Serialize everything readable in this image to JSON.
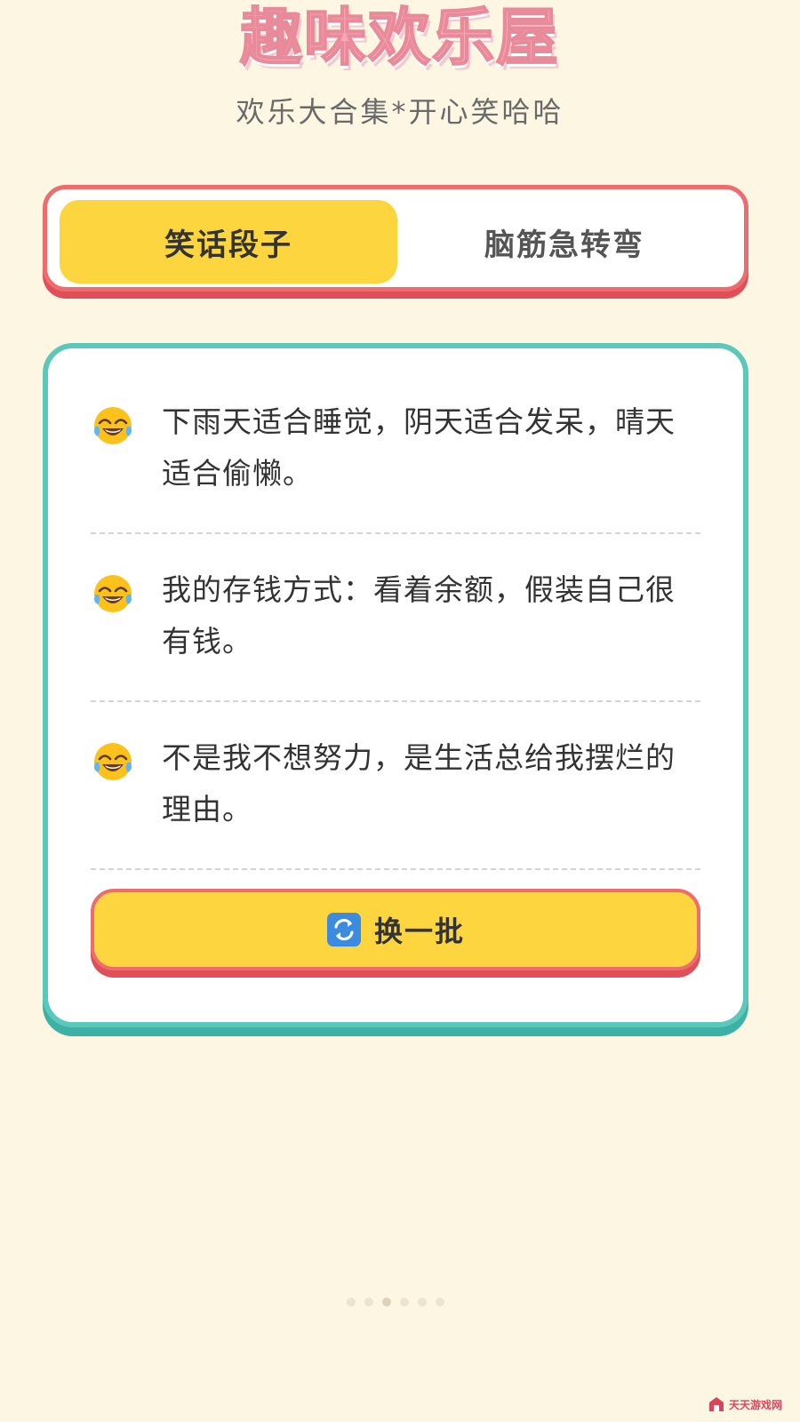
{
  "header": {
    "title": "趣味欢乐屋",
    "subtitle": "欢乐大合集*开心笑哈哈"
  },
  "tabs": [
    {
      "label": "笑话段子",
      "active": true
    },
    {
      "label": "脑筋急转弯",
      "active": false
    }
  ],
  "jokes": [
    {
      "icon": "tears-of-joy-emoji",
      "text": "下雨天适合睡觉，阴天适合发呆，晴天适合偷懒。"
    },
    {
      "icon": "tears-of-joy-emoji",
      "text": "我的存钱方式：看着余额，假装自己很有钱。"
    },
    {
      "icon": "tears-of-joy-emoji",
      "text": "不是我不想努力，是生活总给我摆烂的理由。"
    }
  ],
  "refresh_button": {
    "icon": "refresh-icon",
    "label": "换一批"
  },
  "watermark": {
    "text": "天天游戏网"
  },
  "colors": {
    "background": "#fdf6e3",
    "accent_yellow": "#fcd53f",
    "accent_red": "#ee6b6e",
    "accent_teal": "#5cc8bb",
    "title_pink": "#f7a8b3"
  }
}
